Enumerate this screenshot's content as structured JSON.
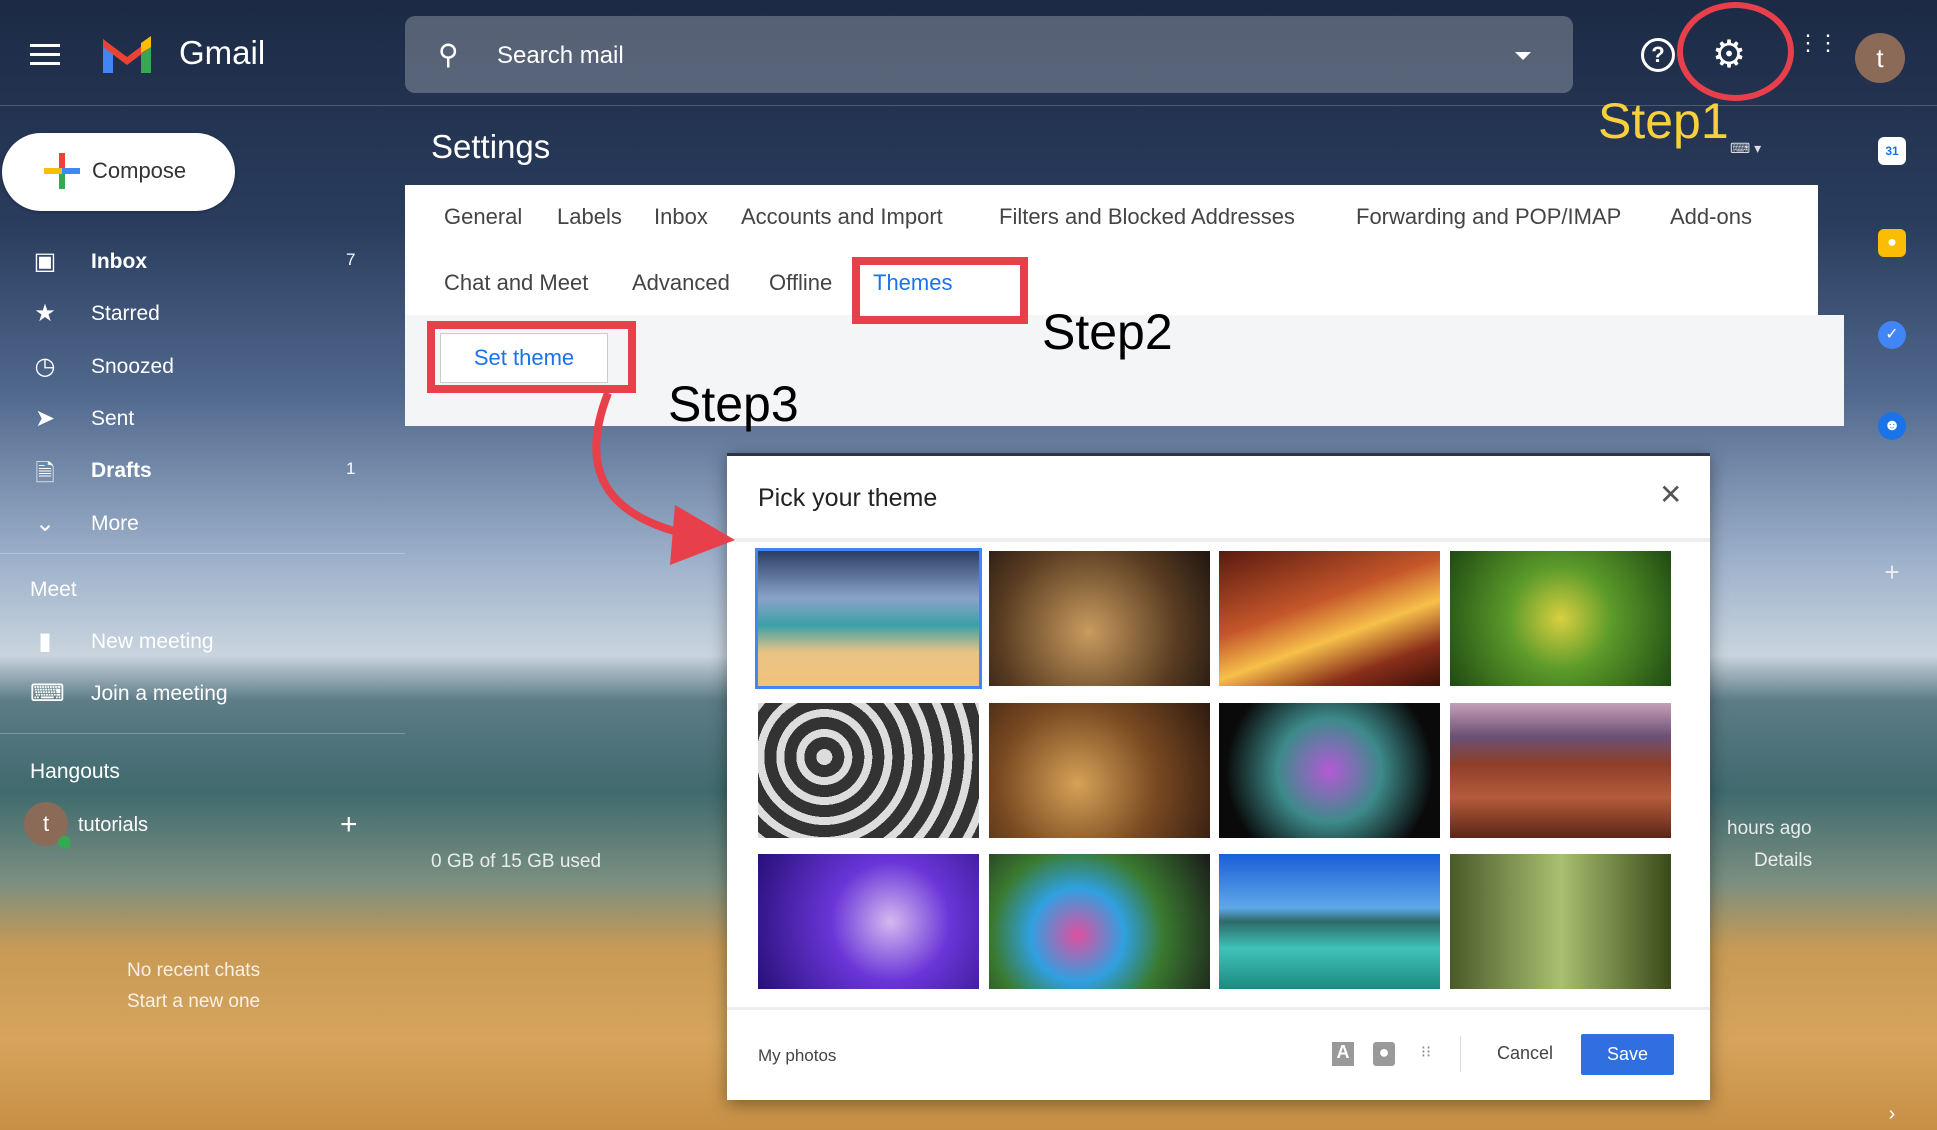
{
  "header": {
    "app_name": "Gmail",
    "search_placeholder": "Search mail",
    "avatar_letter": "t"
  },
  "sidebar": {
    "compose_label": "Compose",
    "items": [
      {
        "label": "Inbox",
        "count": "7",
        "icon": "inbox-icon",
        "bold": true
      },
      {
        "label": "Starred",
        "count": "",
        "icon": "star-icon"
      },
      {
        "label": "Snoozed",
        "count": "",
        "icon": "clock-icon"
      },
      {
        "label": "Sent",
        "count": "",
        "icon": "send-icon"
      },
      {
        "label": "Drafts",
        "count": "1",
        "icon": "draft-icon",
        "bold": true
      },
      {
        "label": "More",
        "count": "",
        "icon": "chevron-down-icon"
      }
    ],
    "meet": {
      "title": "Meet",
      "new_meeting": "New meeting",
      "join_meeting": "Join a meeting"
    },
    "hangouts": {
      "title": "Hangouts",
      "user": "tutorials",
      "user_letter": "t",
      "no_chats": "No recent chats",
      "start_new": "Start a new one"
    }
  },
  "settings": {
    "title": "Settings",
    "tabs_row1": [
      "General",
      "Labels",
      "Inbox",
      "Accounts and Import",
      "Filters and Blocked Addresses",
      "Forwarding and POP/IMAP",
      "Add-ons"
    ],
    "tabs_row2": [
      "Chat and Meet",
      "Advanced",
      "Offline",
      "Themes"
    ],
    "active_tab": "Themes",
    "set_theme_label": "Set theme"
  },
  "background_text": {
    "storage": "0 GB of 15 GB used",
    "last_activity": "hours ago",
    "details": "Details"
  },
  "dialog": {
    "title": "Pick your theme",
    "thumbnails": [
      "beach",
      "chess",
      "canyon",
      "caterpillar",
      "pipes",
      "leaves",
      "bokeh",
      "river-canyon",
      "jellyfish",
      "bubble",
      "lake",
      "forest"
    ],
    "selected_index": 0,
    "my_photos": "My photos",
    "cancel": "Cancel",
    "save": "Save",
    "footer_icons": [
      "text-color-icon",
      "vignette-icon",
      "blur-icon"
    ]
  },
  "annotations": {
    "step1": "Step1",
    "step2": "Step2",
    "step3": "Step3",
    "annotation_red": "#e8404a",
    "step1_color": "#f7d03c"
  },
  "colors": {
    "accent": "#1a73e8",
    "save_button": "#2f6fe0"
  }
}
